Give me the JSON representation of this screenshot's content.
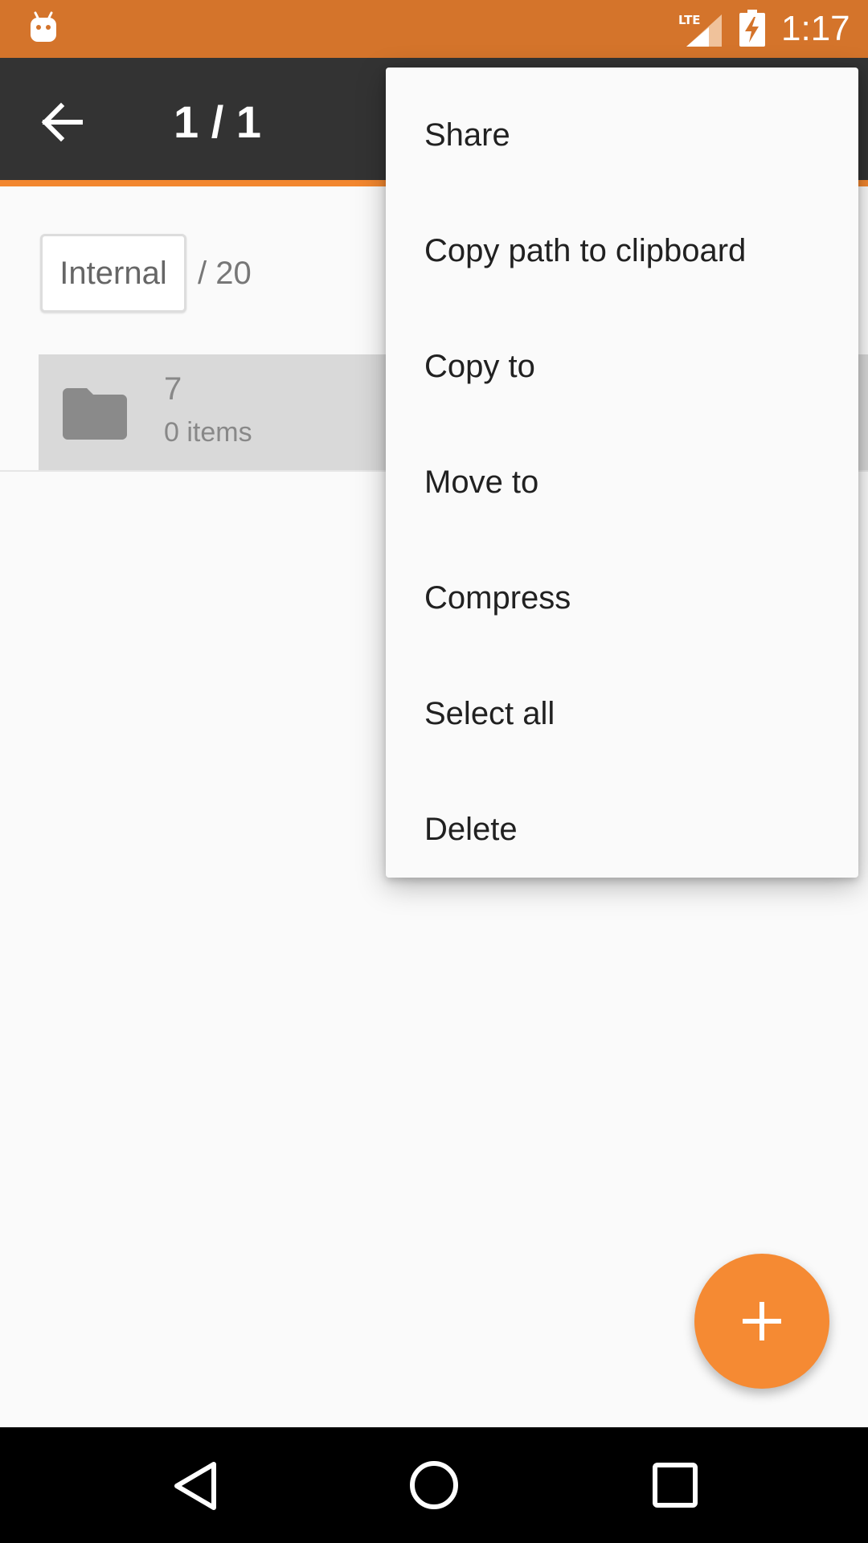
{
  "status_bar": {
    "time": "1:17",
    "network_label": "LTE",
    "icons": [
      "android-notification-icon",
      "lte-signal-icon",
      "battery-charging-icon"
    ]
  },
  "app_bar": {
    "selection_count": "1 / 1",
    "back_icon": "arrow-back-icon",
    "accent_color": "#f2872f",
    "background_color": "#333333"
  },
  "breadcrumb": {
    "root": "Internal",
    "path_rest": "/ 20"
  },
  "file_list": [
    {
      "name": "7",
      "meta": "0 items",
      "icon": "folder-icon",
      "selected": true
    }
  ],
  "popup_menu": {
    "items": [
      "Share",
      "Copy path to clipboard",
      "Copy to",
      "Move to",
      "Compress",
      "Select all",
      "Delete"
    ]
  },
  "fab": {
    "icon": "plus-icon",
    "color": "#f58a33"
  },
  "nav_bar": {
    "icons": [
      "nav-back-icon",
      "nav-home-icon",
      "nav-recents-icon"
    ]
  },
  "colors": {
    "status_bar": "#d4742b",
    "accent": "#f58a33"
  }
}
